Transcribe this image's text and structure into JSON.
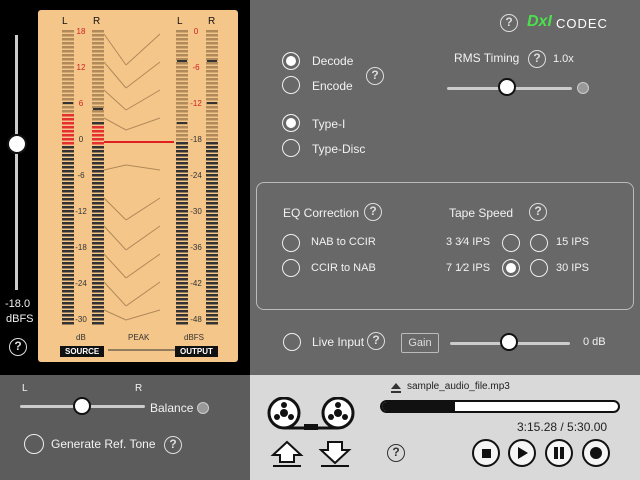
{
  "brand": {
    "logo": "DxI",
    "product": "CODEC"
  },
  "meters": {
    "left_ch": "L",
    "right_ch": "R",
    "source_scale": [
      "18",
      "12",
      "6",
      "0",
      "-6",
      "-12",
      "-18",
      "-24",
      "-30"
    ],
    "output_scale": [
      "0",
      "-6",
      "-12",
      "-18",
      "-24",
      "-30",
      "-36",
      "-42",
      "-48"
    ],
    "source_unit": "dB",
    "output_unit": "dBFS",
    "peak": "PEAK",
    "source_tag": "SOURCE",
    "output_tag": "OUTPUT"
  },
  "input_level": {
    "value": "-18.0",
    "unit": "dBFS"
  },
  "mode": {
    "decode": "Decode",
    "encode": "Encode",
    "selected": "Decode"
  },
  "type": {
    "type1": "Type-I",
    "type_disc": "Type-Disc",
    "selected": "Type-I"
  },
  "rms": {
    "label": "RMS Timing",
    "value": "1.0x",
    "level": 0.45
  },
  "eq": {
    "label": "EQ Correction",
    "opt1": "NAB to CCIR",
    "opt2": "CCIR to NAB"
  },
  "tape": {
    "label": "Tape Speed",
    "s1": "3 3⁄4 IPS",
    "s2": "15 IPS",
    "s3": "7 1⁄2 IPS",
    "s4": "30 IPS",
    "selected": "7 1⁄2 IPS"
  },
  "live": {
    "label": "Live Input",
    "gain": "Gain",
    "gain_value": "0 dB",
    "gain_level": 0.4
  },
  "balance": {
    "l": "L",
    "r": "R",
    "label": "Balance",
    "level": 0.5
  },
  "ref_tone": {
    "label": "Generate Ref. Tone"
  },
  "transport": {
    "file": "sample_audio_file.mp3",
    "time": "3:15.28 / 5:30.00",
    "progress": 0.31
  },
  "icons": [
    "help-icon",
    "eject-icon",
    "reel-icon",
    "upload-icon",
    "download-icon",
    "stop-icon",
    "play-icon",
    "pause-icon",
    "record-icon"
  ]
}
